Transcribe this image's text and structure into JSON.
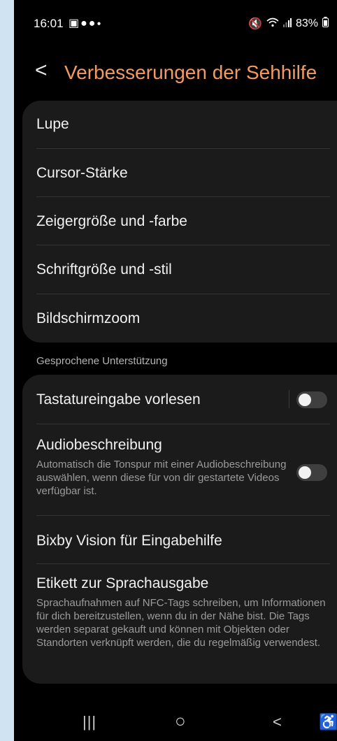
{
  "status_bar": {
    "time": "16:01",
    "notification_icons": [
      "gallery-icon",
      "facebook-icon",
      "facebook-icon",
      "dot-icon"
    ],
    "battery": "83%"
  },
  "header": {
    "back_symbol": "<",
    "title": "Verbesserungen der Sehhilfe"
  },
  "group1": {
    "items": [
      {
        "label": "Lupe"
      },
      {
        "label": "Cursor-Stärke"
      },
      {
        "label": "Zeigergröße und -farbe"
      },
      {
        "label": "Schriftgröße und -stil"
      },
      {
        "label": "Bildschirmzoom"
      }
    ]
  },
  "section_label": "Gesprochene Unterstützung",
  "group2": {
    "tastatureingabe": {
      "label": "Tastatureingabe vorlesen",
      "enabled": false
    },
    "audiobeschreibung": {
      "label": "Audiobeschreibung",
      "description": "Automatisch die Tonspur mit einer Audiobeschreibung auswählen, wenn diese für von dir gestartete Videos verfügbar ist.",
      "enabled": false
    },
    "bixby": {
      "label": "Bixby Vision für Eingabehilfe"
    },
    "etikett": {
      "label": "Etikett zur Sprachausgabe",
      "description": "Sprachaufnahmen auf NFC-Tags schreiben, um Informationen für dich bereitzustellen, wenn du in der Nähe bist. Die Tags werden separat gekauft und können mit Objekten oder Standorten verknüpft werden, die du regelmäßig verwendest."
    }
  },
  "nav_bar": {
    "recents_symbol": "|||",
    "home_symbol": "○",
    "back_symbol": "<",
    "accessibility_symbol": "♿"
  }
}
